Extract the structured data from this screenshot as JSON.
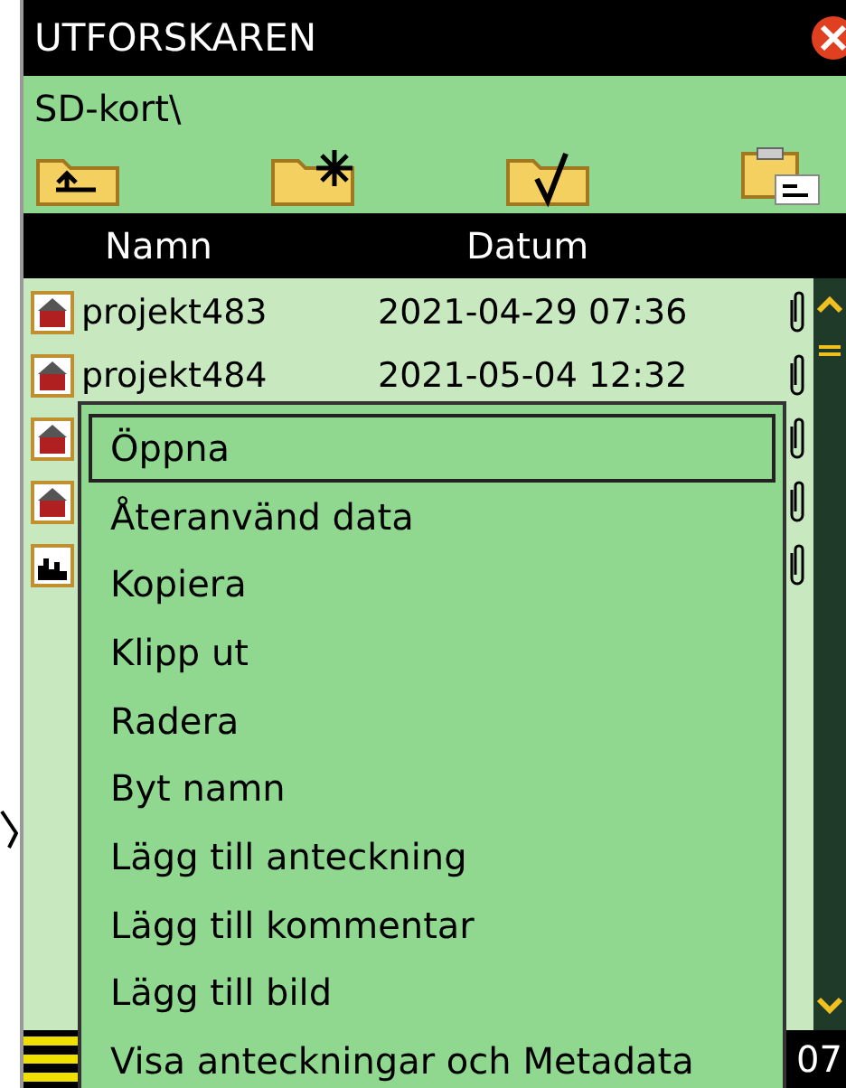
{
  "window": {
    "title": "UTFORSKAREN"
  },
  "path": "SD-kort\\",
  "toolbar": [
    {
      "kind": "up"
    },
    {
      "kind": "new"
    },
    {
      "kind": "check"
    },
    {
      "kind": "clipboard"
    }
  ],
  "columns": [
    "Namn",
    "Datum"
  ],
  "files": [
    {
      "kind": "project",
      "name": "projekt483",
      "date": "2021-04-29 07:36",
      "attachment": true
    },
    {
      "kind": "project",
      "name": "projekt484",
      "date": "2021-05-04 12:32",
      "attachment": true
    },
    {
      "kind": "project",
      "attachment": true
    },
    {
      "kind": "project",
      "attachment": true
    },
    {
      "kind": "chart",
      "attachment": true
    }
  ],
  "menu": [
    {
      "label": "Öppna",
      "selected": true
    },
    {
      "label": "Återanvänd data",
      "selected": false
    },
    {
      "label": "Kopiera",
      "selected": false
    },
    {
      "label": "Klipp ut",
      "selected": false
    },
    {
      "label": "Radera",
      "selected": false
    },
    {
      "label": "Byt namn",
      "selected": false
    },
    {
      "label": "Lägg till anteckning",
      "selected": false
    },
    {
      "label": "Lägg till kommentar",
      "selected": false
    },
    {
      "label": "Lägg till bild",
      "selected": false
    },
    {
      "label": "Visa anteckningar och Metadata",
      "selected": false
    }
  ],
  "status_bar": {
    "text": "07"
  }
}
